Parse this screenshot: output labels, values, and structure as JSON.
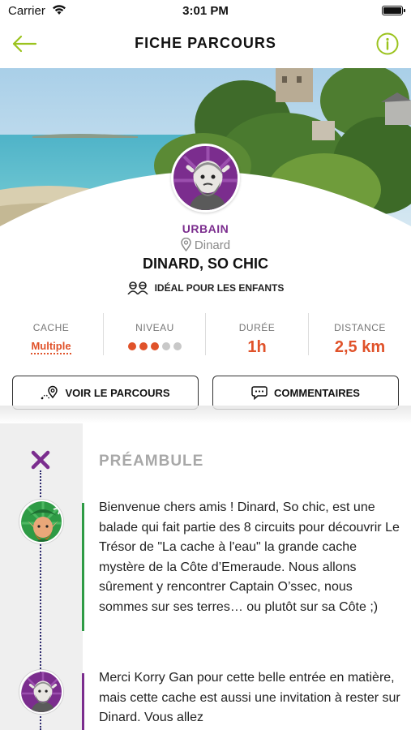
{
  "status_bar": {
    "carrier": "Carrier",
    "time": "3:01 PM"
  },
  "nav": {
    "title": "FICHE PARCOURS",
    "accent_color": "#9bc31e"
  },
  "route": {
    "category": "URBAIN",
    "location": "Dinard",
    "title": "DINARD, SO CHIC",
    "kids_label": "IDÉAL POUR LES ENFANTS"
  },
  "stats": {
    "cache_label": "CACHE",
    "cache_value": "Multiple",
    "level_label": "NIVEAU",
    "level_value": 3,
    "level_max": 5,
    "duration_label": "DURÉE",
    "duration_value": "1h",
    "distance_label": "DISTANCE",
    "distance_value": "2,5 km"
  },
  "actions": {
    "route_button": "VOIR LE PARCOURS",
    "comments_button": "COMMENTAIRES"
  },
  "section": {
    "title": "PRÉAMBULE"
  },
  "messages": [
    {
      "avatar": "korry-gan-elf-icon",
      "bar_color": "#2e9b45",
      "text": "Bienvenue chers amis ! Dinard, So chic, est une balade qui fait partie des 8 circuits pour découvrir Le Trésor de \"La cache à l'eau\" la grande cache mystère de la Côte d’Emeraude. Nous allons sûrement y rencontrer Captain O’ssec, nous sommes sur ses terres… ou plutôt sur sa Côte ;)"
    },
    {
      "avatar": "bearded-guide-icon",
      "bar_color": "#7b2d8e",
      "text": "Merci Korry Gan pour cette belle entrée en matière, mais cette cache est aussi une invitation à rester sur Dinard. Vous allez"
    }
  ],
  "colors": {
    "purple": "#7b2d8e",
    "orange": "#e0522a",
    "navy": "#2d2a6e"
  }
}
